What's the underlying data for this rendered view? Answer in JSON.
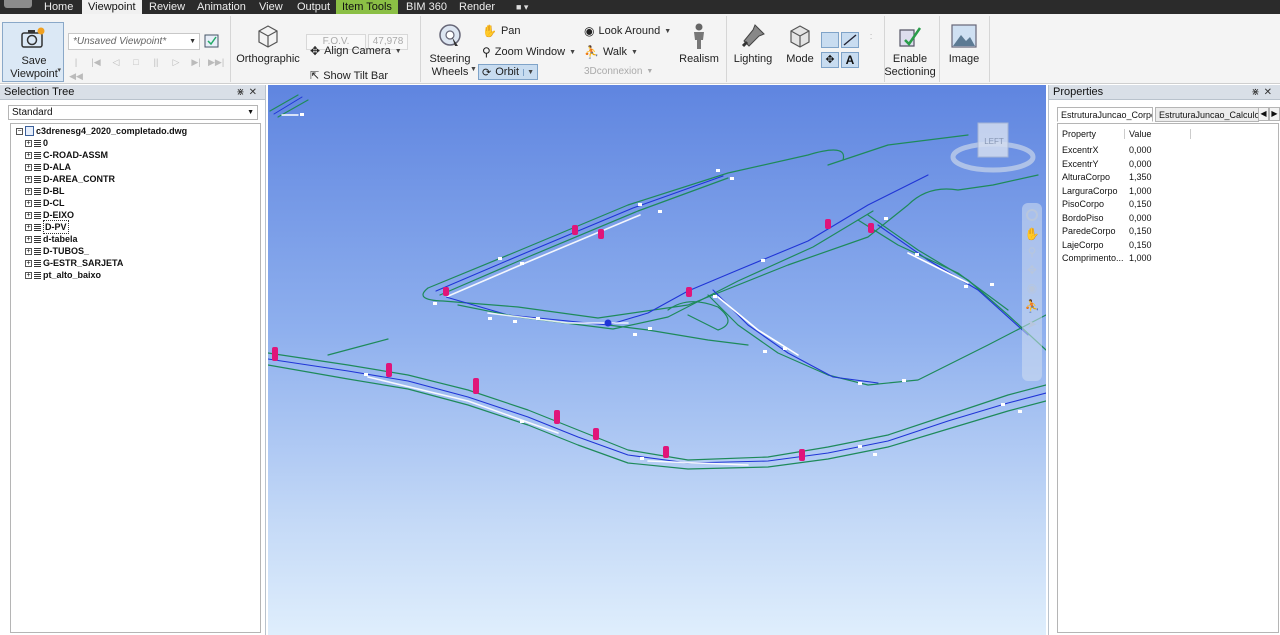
{
  "menubar": {
    "tabs": [
      "Home",
      "Viewpoint",
      "Review",
      "Animation",
      "View",
      "Output",
      "Item Tools",
      "BIM 360",
      "Render"
    ],
    "active_tab": "Viewpoint",
    "contextual_tab": "Item Tools"
  },
  "ribbon": {
    "save_viewpoint": "Save\nViewpoint",
    "save_line1": "Save",
    "save_line2": "Viewpoint",
    "viewpoint_select": "*Unsaved Viewpoint*",
    "orthographic": "Orthographic",
    "fov_label": "F.O.V.",
    "fov_value": "47,978",
    "align_camera": "Align Camera",
    "show_tilt_bar": "Show Tilt Bar",
    "steering_line1": "Steering",
    "steering_line2": "Wheels",
    "pan": "Pan",
    "zoom_window": "Zoom Window",
    "orbit": "Orbit",
    "look_around": "Look Around",
    "walk": "Walk",
    "connexion": "3Dconnexion",
    "realism": "Realism",
    "lighting": "Lighting",
    "mode": "Mode",
    "enable_line1": "Enable",
    "enable_line2": "Sectioning",
    "image": "Image"
  },
  "selection_tree": {
    "title": "Selection Tree",
    "filter": "Standard",
    "root": "c3drenesg4_2020_completado.dwg",
    "layers": [
      "0",
      "C-ROAD-ASSM",
      "D-ALA",
      "D-AREA_CONTR",
      "D-BL",
      "D-CL",
      "D-EIXO",
      "D-PV",
      "d-tabela",
      "D-TUBOS_",
      "G-ESTR_SARJETA",
      "pt_alto_baixo"
    ],
    "selected_layer": "D-PV"
  },
  "viewcube": {
    "face": "LEFT"
  },
  "properties": {
    "title": "Properties",
    "tabs": [
      "EstruturaJuncao_Corpo",
      "EstruturaJuncao_Calculos"
    ],
    "active_tab": "EstruturaJuncao_Corpo",
    "header_property": "Property",
    "header_value": "Value",
    "rows": [
      {
        "k": "ExcentrX",
        "v": "0,000"
      },
      {
        "k": "ExcentrY",
        "v": "0,000"
      },
      {
        "k": "AlturaCorpo",
        "v": "1,350"
      },
      {
        "k": "LarguraCorpo",
        "v": "1,000"
      },
      {
        "k": "PisoCorpo",
        "v": "0,150"
      },
      {
        "k": "BordoPiso",
        "v": "0,000"
      },
      {
        "k": "ParedeCorpo",
        "v": "0,150"
      },
      {
        "k": "LajeCorpo",
        "v": "0,150"
      },
      {
        "k": "Comprimento...",
        "v": "1,000"
      }
    ]
  },
  "colors": {
    "accent": "#8bbf45",
    "network_green": "#1e8a5a",
    "network_blue": "#1f35d6",
    "structure_magenta": "#e0157a"
  }
}
